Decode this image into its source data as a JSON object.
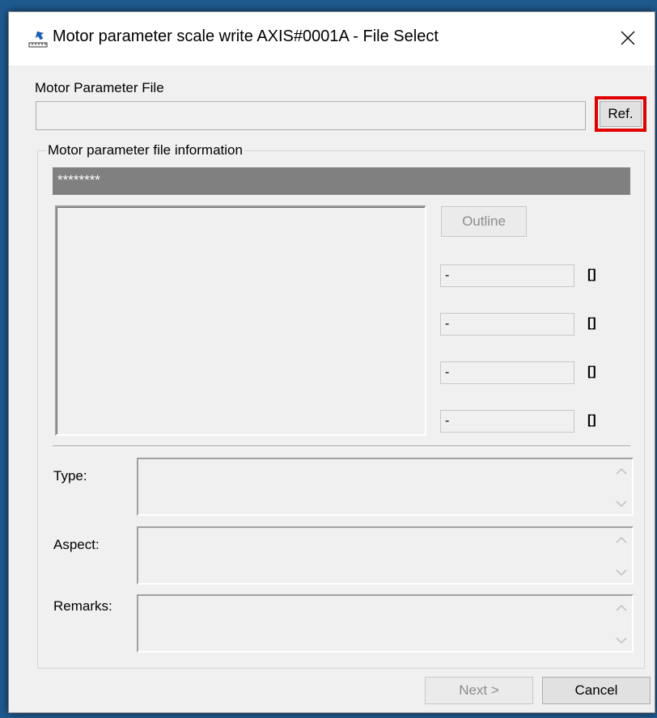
{
  "window": {
    "title": "Motor parameter scale write AXIS#0001A - File Select",
    "icon": "motor-scale-icon",
    "close_icon": "close-icon"
  },
  "file_section": {
    "label": "Motor Parameter File",
    "path_value": "",
    "ref_button": "Ref."
  },
  "info_group": {
    "legend": "Motor parameter file information",
    "header_value": "********",
    "outline_button": "Outline",
    "values": [
      {
        "value": "-",
        "unit": "[]"
      },
      {
        "value": "-",
        "unit": "[]"
      },
      {
        "value": "-",
        "unit": "[]"
      },
      {
        "value": "-",
        "unit": "[]"
      }
    ],
    "type_label": "Type:",
    "type_value": "",
    "aspect_label": "Aspect:",
    "aspect_value": "",
    "remarks_label": "Remarks:",
    "remarks_value": ""
  },
  "footer": {
    "next_button": "Next >",
    "cancel_button": "Cancel"
  },
  "colors": {
    "highlight": "#e00000",
    "header_bar": "#808080",
    "window_bg": "#f0f0f0"
  }
}
